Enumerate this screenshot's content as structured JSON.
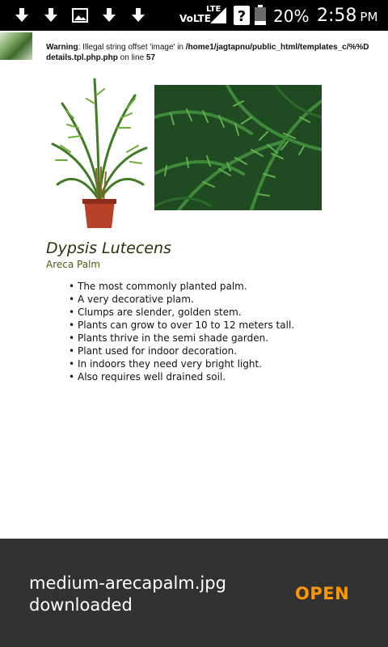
{
  "status_bar": {
    "notification_icons": [
      "download-icon",
      "download-icon",
      "image-icon",
      "download-icon",
      "download-icon"
    ],
    "network_label": "VoLTE",
    "lte_label": "LTE",
    "battery_percent": "20%",
    "time": "2:58",
    "ampm": "PM"
  },
  "page": {
    "warning_prefix": "Warning",
    "warning_text": ": Illegal string offset 'image' in ",
    "warning_path": "/home1/jagtapnu/public_html/templates_c/%%D",
    "warning_file": "details.tpl.php.php",
    "warning_line_text": " on line ",
    "warning_line_number": "57",
    "scientific_name": "Dypsis Lutecens",
    "common_name": "Areca Palm",
    "bullets": [
      "The most commonly planted palm.",
      "A very decorative plam.",
      "Clumps are slender, golden stem.",
      "Plants can grow to over 10 to 12 meters tall.",
      "Plants thrive in the semi shade garden.",
      "Plant used for indoor decoration.",
      "In indoors they need very bright light.",
      "Also requires well drained soil."
    ]
  },
  "snackbar": {
    "message_line1": "medium-arecapalm.jpg",
    "message_line2": "downloaded",
    "action_label": "OPEN",
    "action_color": "#ff9800"
  }
}
